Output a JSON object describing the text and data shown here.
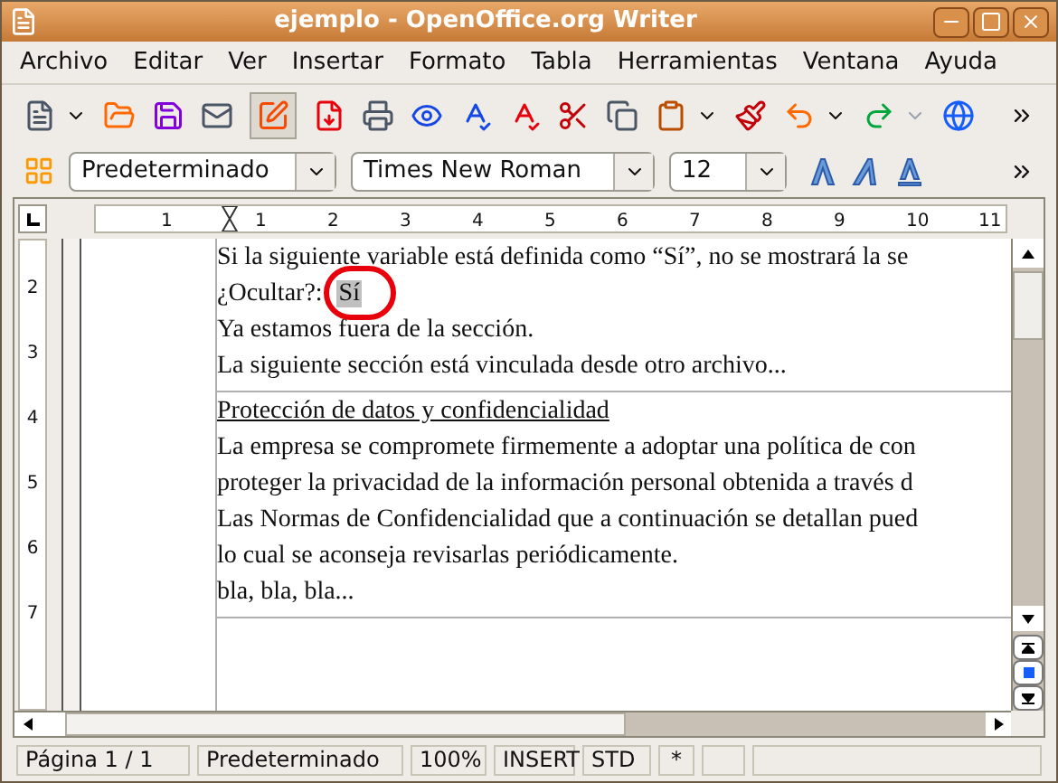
{
  "window": {
    "title": "ejemplo - OpenOffice.org Writer"
  },
  "menu": [
    "Archivo",
    "Editar",
    "Ver",
    "Insertar",
    "Formato",
    "Tabla",
    "Herramientas",
    "Ventana",
    "Ayuda"
  ],
  "formatting": {
    "style": "Predeterminado",
    "font": "Times New Roman",
    "size": "12"
  },
  "ruler": {
    "horizontal": [
      "1",
      "1",
      "2",
      "3",
      "4",
      "5",
      "6",
      "7",
      "8",
      "9",
      "10",
      "11"
    ],
    "vertical": [
      "2",
      "3",
      "4",
      "5",
      "6",
      "7"
    ]
  },
  "document": {
    "sections": [
      {
        "paragraphs": [
          {
            "text": "Si la siguiente variable está definida como “Sí”, no se mostrará la se"
          },
          {
            "text": "¿Ocultar?:",
            "field": "Sí"
          },
          {
            "text": "Ya estamos fuera de la sección."
          },
          {
            "text": "La siguiente sección está vinculada desde otro archivo..."
          }
        ]
      },
      {
        "paragraphs": [
          {
            "text": "Protección de datos y confidencialidad",
            "underline": true
          },
          {
            "text": "La empresa se compromete firmemente a adoptar una política de con"
          },
          {
            "text": "proteger la privacidad de la información personal obtenida a través d"
          },
          {
            "text": "Las Normas de Confidencialidad que a continuación se detallan pued"
          },
          {
            "text": "lo cual se aconseja revisarlas periódicamente."
          },
          {
            "text": "bla, bla, bla..."
          }
        ]
      }
    ]
  },
  "status_bar": [
    "Página  1 / 1",
    "Predeterminado",
    "100%",
    "INSERT",
    "STD",
    "*"
  ]
}
